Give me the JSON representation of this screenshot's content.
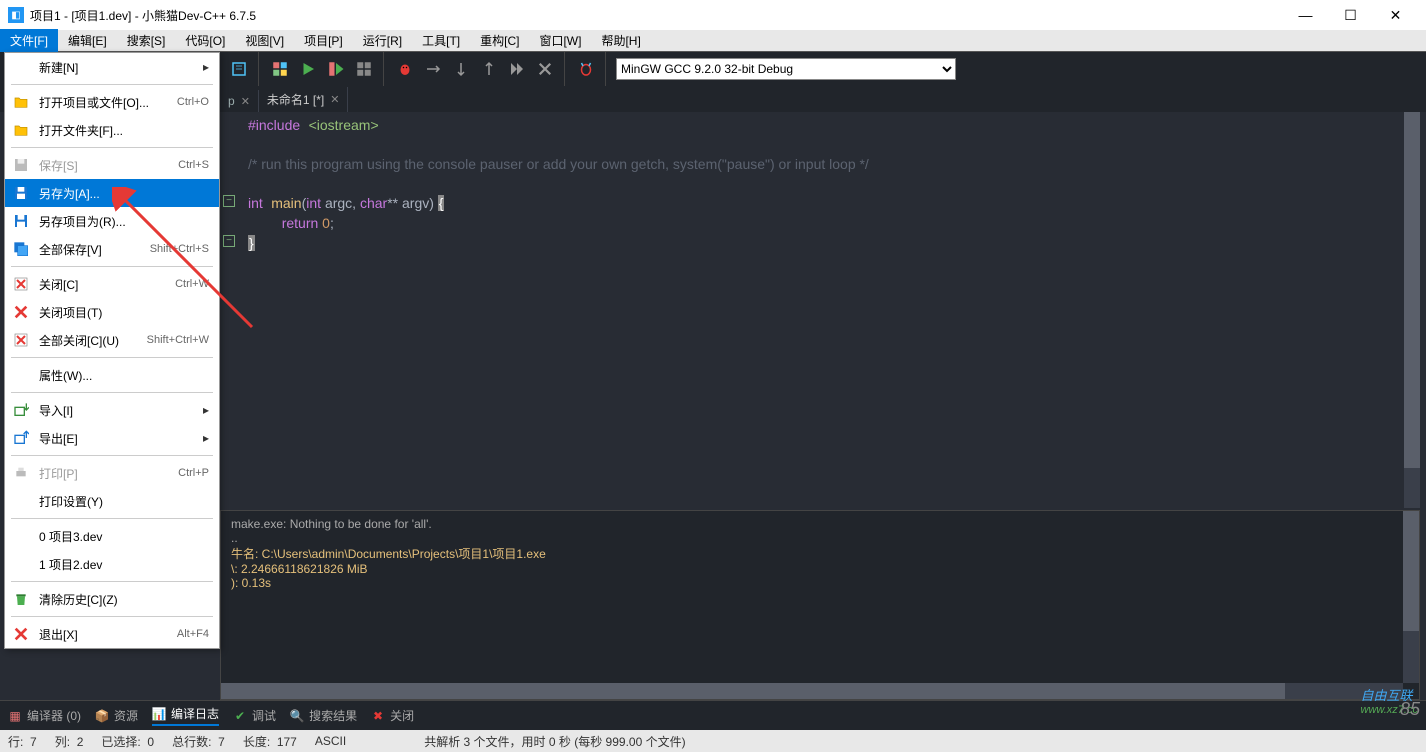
{
  "title": "项目1 - [项目1.dev] - 小熊猫Dev-C++ 6.7.5",
  "menubar": [
    "文件[F]",
    "编辑[E]",
    "搜索[S]",
    "代码[O]",
    "视图[V]",
    "项目[P]",
    "运行[R]",
    "工具[T]",
    "重构[C]",
    "窗口[W]",
    "帮助[H]"
  ],
  "compiler_select": "MinGW GCC 9.2.0 32-bit Debug",
  "tabs": [
    {
      "label": "p",
      "active": false
    },
    {
      "label": "未命名1 [*]",
      "active": true
    }
  ],
  "file_menu": [
    {
      "type": "item",
      "label": "新建[N]",
      "arrow": true,
      "icon": ""
    },
    {
      "type": "sep"
    },
    {
      "type": "item",
      "label": "打开项目或文件[O]...",
      "shortcut": "Ctrl+O",
      "icon": "folder-yellow"
    },
    {
      "type": "item",
      "label": "打开文件夹[F]...",
      "icon": "folder-yellow"
    },
    {
      "type": "sep"
    },
    {
      "type": "item",
      "label": "保存[S]",
      "shortcut": "Ctrl+S",
      "disabled": true,
      "icon": "disk-gray"
    },
    {
      "type": "item",
      "label": "另存为[A]...",
      "highlighted": true,
      "icon": "disk"
    },
    {
      "type": "item",
      "label": "另存项目为(R)...",
      "icon": "disk"
    },
    {
      "type": "item",
      "label": "全部保存[V]",
      "shortcut": "Shift+Ctrl+S",
      "icon": "disk-multi"
    },
    {
      "type": "sep"
    },
    {
      "type": "item",
      "label": "关闭[C]",
      "shortcut": "Ctrl+W",
      "icon": "close-red"
    },
    {
      "type": "item",
      "label": "关闭项目(T)",
      "icon": "close-x"
    },
    {
      "type": "item",
      "label": "全部关闭[C](U)",
      "shortcut": "Shift+Ctrl+W",
      "icon": "close-red"
    },
    {
      "type": "sep"
    },
    {
      "type": "item",
      "label": "属性(W)..."
    },
    {
      "type": "sep"
    },
    {
      "type": "item",
      "label": "导入[I]",
      "arrow": true,
      "icon": "import"
    },
    {
      "type": "item",
      "label": "导出[E]",
      "arrow": true,
      "icon": "export"
    },
    {
      "type": "sep"
    },
    {
      "type": "item",
      "label": "打印[P]",
      "shortcut": "Ctrl+P",
      "disabled": true,
      "icon": "printer"
    },
    {
      "type": "item",
      "label": "打印设置(Y)"
    },
    {
      "type": "sep"
    },
    {
      "type": "item",
      "label": "0 项目3.dev"
    },
    {
      "type": "item",
      "label": "1 项目2.dev"
    },
    {
      "type": "sep"
    },
    {
      "type": "item",
      "label": "清除历史[C](Z)",
      "icon": "trash"
    },
    {
      "type": "sep"
    },
    {
      "type": "item",
      "label": "退出[X]",
      "shortcut": "Alt+F4",
      "icon": "close-x"
    }
  ],
  "code": {
    "l1a": "#include",
    "l1b": "<iostream>",
    "l2": "/* run this program using the console pauser or add your own getch, system(\"pause\") or input loop */",
    "l3_int": "int",
    "l3_main": "main",
    "l3_open": "(",
    "l3_int2": "int",
    "l3_argc": " argc, ",
    "l3_char": "char",
    "l3_rest": "** argv) ",
    "l3_br": "{",
    "l4_ret": "return",
    "l4_zero": " 0",
    "l4_semi": ";",
    "l5": "}"
  },
  "output": {
    "l1": "make.exe: Nothing to be done for 'all'.",
    "l2": "..",
    "l3": "",
    "l4": "牛名: C:\\Users\\admin\\Documents\\Projects\\项目1\\项目1.exe",
    "l5": "\\: 2.24666118621826 MiB",
    "l6": "): 0.13s"
  },
  "bottom_tabs": {
    "compiler": "编译器 (0)",
    "resource": "资源",
    "log": "编译日志",
    "debug": "调试",
    "search": "搜索结果",
    "close": "关闭"
  },
  "statusbar": {
    "line": "行:",
    "line_v": "7",
    "col": "列:",
    "col_v": "2",
    "sel": "已选择:",
    "sel_v": "0",
    "total": "总行数:",
    "total_v": "7",
    "len": "长度:",
    "len_v": "177",
    "enc": "ASCII",
    "parse": "共解析 3 个文件，用时 0 秒 (每秒 999.00 个文件)"
  },
  "watermark": {
    "brand": "自由互联",
    "url": "www.xz7.cc",
    "num": "85"
  }
}
